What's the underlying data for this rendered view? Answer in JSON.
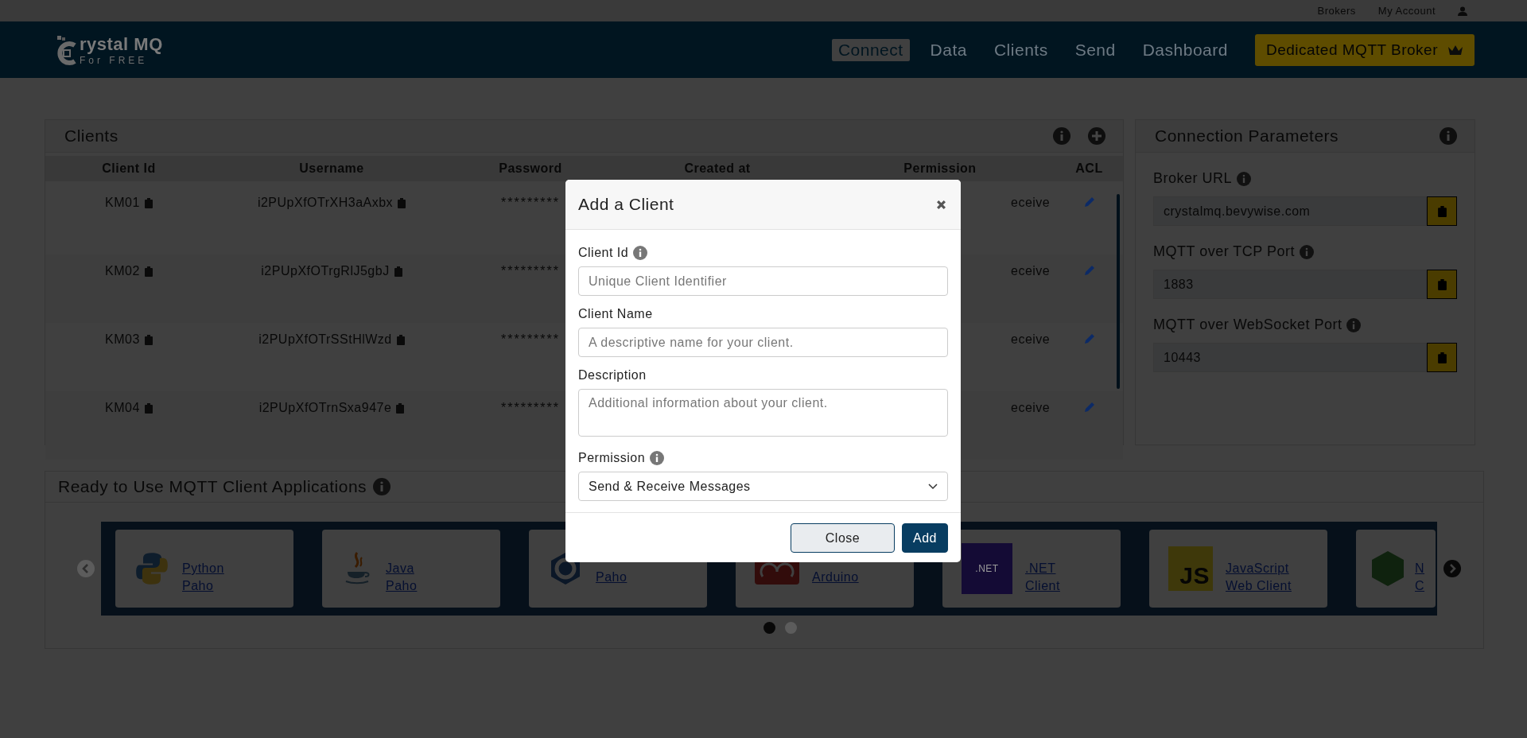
{
  "top_links": [
    {
      "label": "Brokers"
    },
    {
      "label": "My Account"
    }
  ],
  "logo": {
    "text": "rystal MQ",
    "subtext": "For FREE"
  },
  "nav": [
    {
      "label": "Connect",
      "selected": true
    },
    {
      "label": "Data",
      "selected": false
    },
    {
      "label": "Clients",
      "selected": false
    },
    {
      "label": "Send",
      "selected": false
    },
    {
      "label": "Dashboard",
      "selected": false
    }
  ],
  "nav_button": "Dedicated MQTT Broker",
  "clients": {
    "title": "Clients",
    "columns": [
      "Client Id",
      "Username",
      "Password",
      "Created at",
      "Permission",
      "ACL"
    ],
    "rows": [
      {
        "client_id": "KM01",
        "username": "i2PUpXfOTrXH3aAxbx",
        "password": "*********",
        "permission": "eceive"
      },
      {
        "client_id": "KM02",
        "username": "i2PUpXfOTrgRlJ5gbJ",
        "password": "*********",
        "permission": "eceive"
      },
      {
        "client_id": "KM03",
        "username": "i2PUpXfOTrSStHlWzd",
        "password": "*********",
        "permission": "eceive"
      },
      {
        "client_id": "KM04",
        "username": "i2PUpXfOTrnSxa947e",
        "password": "*********",
        "permission": "eceive"
      }
    ]
  },
  "connection": {
    "title": "Connection Parameters",
    "fields": [
      {
        "label": "Broker URL",
        "value": "crystalmq.bevywise.com"
      },
      {
        "label": "MQTT over TCP Port",
        "value": "1883"
      },
      {
        "label": "MQTT over WebSocket Port",
        "value": "10443"
      }
    ]
  },
  "apps": {
    "title": "Ready to Use MQTT Client Applications",
    "cards": [
      {
        "kind": "python",
        "name": "Python",
        "sub": "Paho"
      },
      {
        "kind": "java",
        "name": "Java",
        "sub": "Paho"
      },
      {
        "kind": "eclipse",
        "sub": "Paho"
      },
      {
        "kind": "arduino",
        "sub": "Arduino"
      },
      {
        "kind": "dotnet",
        "name": ".NET",
        "sub": "Client",
        "icon_text": ".NET"
      },
      {
        "kind": "js",
        "name": "JavaScript",
        "sub": "Web Client",
        "icon_text": "JS"
      },
      {
        "kind": "node",
        "name": "N",
        "sub": "C"
      }
    ],
    "dots": [
      {
        "selected": true
      },
      {
        "selected": false
      }
    ]
  },
  "modal": {
    "title": "Add a Client",
    "fields": [
      {
        "kind": "input",
        "label": "Client Id",
        "info": true,
        "placeholder": "Unique Client Identifier"
      },
      {
        "kind": "input",
        "label": "Client Name",
        "info": false,
        "placeholder": "A descriptive name for your client."
      },
      {
        "kind": "textarea",
        "label": "Description",
        "info": false,
        "placeholder": "Additional information about your client."
      },
      {
        "kind": "select",
        "label": "Permission",
        "info": true,
        "value": "Send & Receive Messages"
      }
    ],
    "buttons": [
      {
        "label": "Close",
        "kind": "secondary"
      },
      {
        "label": "Add",
        "kind": "primary"
      }
    ]
  }
}
